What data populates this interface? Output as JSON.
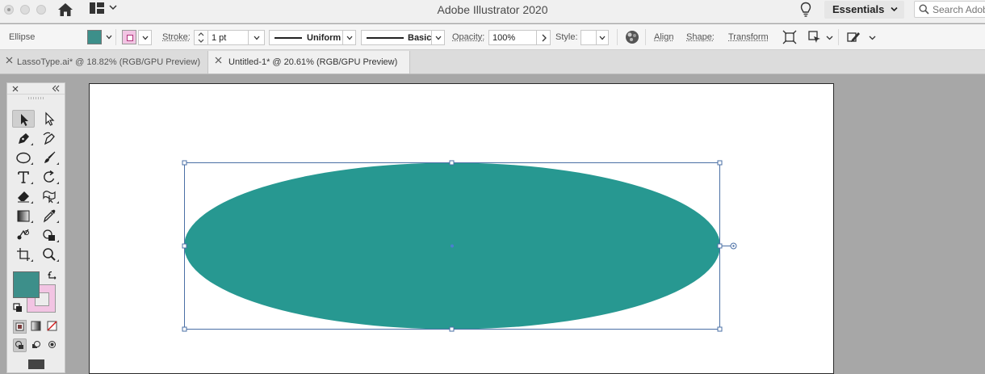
{
  "titlebar": {
    "app_title": "Adobe Illustrator 2020",
    "workspace": "Essentials",
    "search_placeholder": "Search Adobe"
  },
  "controlbar": {
    "object_type": "Ellipse",
    "fill_color": "#3d8f8a",
    "stroke_color": "#f2c4e3",
    "stroke_label": "Stroke:",
    "stroke_weight": "1 pt",
    "variable_width_label": "Uniform",
    "brush_label": "Basic",
    "opacity_label": "Opacity:",
    "opacity_value": "100%",
    "style_label": "Style:",
    "align_label": "Align",
    "shape_label": "Shape:",
    "transform_label": "Transform"
  },
  "tabs": [
    {
      "label": "LassoType.ai* @ 18.82% (RGB/GPU Preview)",
      "active": false
    },
    {
      "label": "Untitled-1* @ 20.61% (RGB/GPU Preview)",
      "active": true
    }
  ],
  "tools": {
    "items": [
      "selection-tool",
      "direct-selection-tool",
      "pen-tool",
      "curvature-tool",
      "ellipse-tool",
      "paintbrush-tool",
      "type-tool",
      "rotate-tool",
      "eraser-tool",
      "puppet-warp-tool",
      "gradient-tool",
      "eyedropper-tool",
      "blend-tool",
      "shape-builder-tool",
      "artboard-tool",
      "zoom-tool"
    ],
    "selected": "selection-tool"
  },
  "canvas": {
    "artboard_color": "#ffffff",
    "ellipse_fill": "#279891",
    "selection_color": "#4a6fa5"
  }
}
